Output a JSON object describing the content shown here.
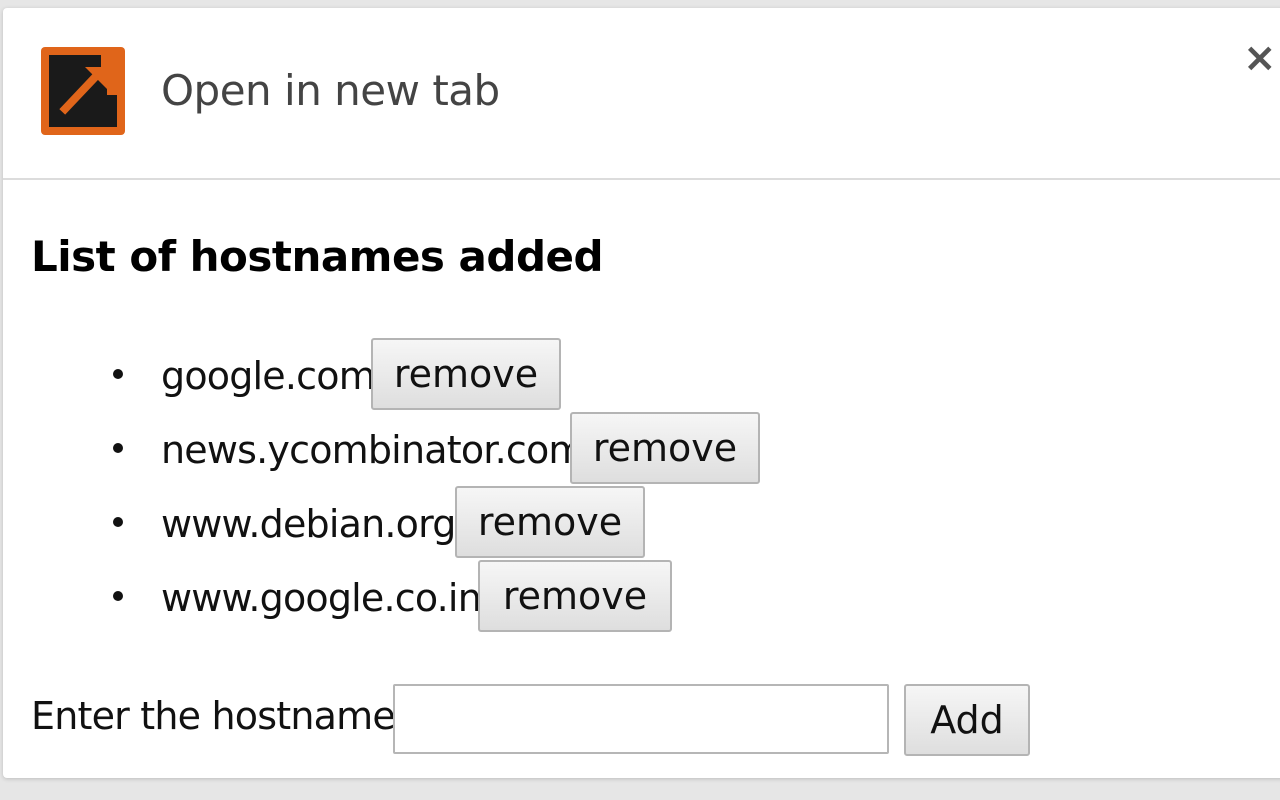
{
  "header": {
    "title": "Open in new tab",
    "app_icon": "open-in-new-tab-icon",
    "close_glyph": "×",
    "accent_color": "#e0651a"
  },
  "list": {
    "title": "List of hostnames added",
    "items": [
      {
        "hostname": "google.com",
        "action": "remove"
      },
      {
        "hostname": "news.ycombinator.com",
        "action": "remove"
      },
      {
        "hostname": "www.debian.org",
        "action": "remove"
      },
      {
        "hostname": "www.google.co.in",
        "action": "remove"
      }
    ]
  },
  "add_form": {
    "label": "Enter the hostname",
    "input_value": "",
    "button_label": "Add"
  }
}
